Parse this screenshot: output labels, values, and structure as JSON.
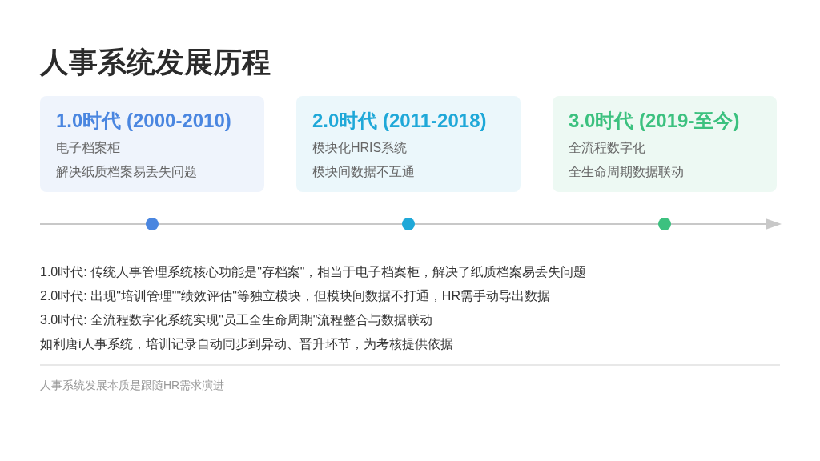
{
  "title": "人事系统发展历程",
  "eras": [
    {
      "heading": "1.0时代 (2000-2010)",
      "color": "#4a86e0",
      "lines": [
        "电子档案柜",
        "解决纸质档案易丢失问题"
      ]
    },
    {
      "heading": "2.0时代 (2011-2018)",
      "color": "#1fa8d8",
      "lines": [
        "模块化HRIS系统",
        "模块间数据不互通"
      ]
    },
    {
      "heading": "3.0时代 (2019-至今)",
      "color": "#3cc17f",
      "lines": [
        "全流程数字化",
        "全生命周期数据联动"
      ]
    }
  ],
  "notes": [
    "1.0时代: 传统人事管理系统核心功能是\"存档案\"，相当于电子档案柜，解决了纸质档案易丢失问题",
    "2.0时代: 出现\"培训管理\"\"绩效评估\"等独立模块，但模块间数据不打通，HR需手动导出数据",
    "3.0时代: 全流程数字化系统实现\"员工全生命周期\"流程整合与数据联动",
    "如利唐i人事系统，培训记录自动同步到异动、晋升环节，为考核提供依据"
  ],
  "footer": "人事系统发展本质是跟随HR需求演进"
}
